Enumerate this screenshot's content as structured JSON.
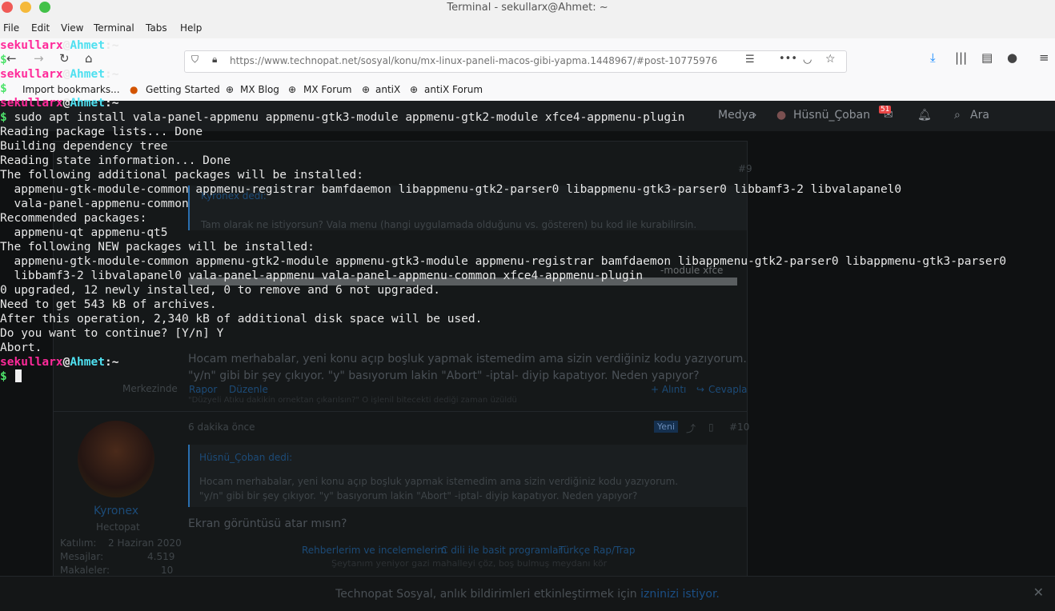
{
  "window": {
    "title": "Terminal - sekullarx@Ahmet: ~"
  },
  "menu": [
    "File",
    "Edit",
    "View",
    "Terminal",
    "Tabs",
    "Help"
  ],
  "browser": {
    "url": "https://www.technopat.net/sosyal/konu/mx-linux-paneli-macos-gibi-yapma.1448967/#post-10775976",
    "bookmarks": [
      "Import bookmarks...",
      "Getting Started",
      "MX Blog",
      "MX Forum",
      "antiX",
      "antiX Forum"
    ],
    "site_nav": {
      "media": "Medya",
      "user": "Hüsnü_Çoban",
      "notif_count": "51",
      "search": "Ara"
    },
    "post9": {
      "number": "#9",
      "quote_author": "Kyronex dedi:",
      "quote_text": "Tam olarak ne istiyorsun? Vala menu (hangi uygulamada olduğunu vs. gösteren) bu kod ile kurabilirsin.",
      "code_fragment": "-module xfce",
      "body_line1": "Hocam merhabalar, yeni konu açıp boşluk yapmak istemedim ama sizin verdiğiniz kodu yazıyorum.",
      "body_line2": "\"y/n\" gibi bir şey çıkıyor. \"y\" basıyorum lakin \"Abort\" -iptal- diyip kapatıyor. Neden yapıyor?",
      "edit_note": "\"Düzyeli Atıku dakikin ornektan çıkarılsın?\" O işlenil bitecekti dediği zaman üzüldü",
      "report": "Rapor",
      "edit": "Düzenle",
      "quote_btn": "+ Alıntı",
      "reply_btn": "Cevapla",
      "user_location": "Merkezinde"
    },
    "post10": {
      "time": "6 dakika önce",
      "badge": "Yeni",
      "number": "#10",
      "quote_author": "Hüsnü_Çoban dedi:",
      "quote_line1": "Hocam merhabalar, yeni konu açıp boşluk yapmak istemedim ama sizin verdiğiniz kodu yazıyorum.",
      "quote_line2": "\"y/n\" gibi bir şey çıkıyor. \"y\" basıyorum lakin \"Abort\" -iptal- diyip kapatıyor. Neden yapıyor?",
      "body": "Ekran görüntüsü atar mısın?",
      "signature_link1": "Rehberlerim ve incelemelerim",
      "signature_link2": "C dili ile basit programlar",
      "signature_link3": "Türkçe Rap/Trap",
      "signature_line2": "Şeytanım yeniyor gazi mahalleyi çöz, boş bulmuş meydanı kör"
    },
    "user": {
      "name": "Kyronex",
      "title": "Hectopat",
      "joined_label": "Katılım:",
      "joined_value": "2 Haziran 2020",
      "messages_label": "Mesajlar:",
      "messages_value": "4.519",
      "articles_label": "Makaleler:",
      "articles_value": "10"
    },
    "notice": {
      "text": "Technopat Sosyal, anlık bildirimleri etkinleştirmek için",
      "link": "izninizi istiyor."
    }
  },
  "terminal": {
    "prompt_user": "sekullarx",
    "prompt_at": "@",
    "prompt_host": "Ahmet",
    "prompt_path": ":~",
    "prompt_symbol": "$",
    "command": " sudo apt install vala-panel-appmenu appmenu-gtk3-module appmenu-gtk2-module xfce4-appmenu-plugin",
    "output": [
      "Reading package lists... Done",
      "Building dependency tree",
      "Reading state information... Done",
      "The following additional packages will be installed:",
      "  appmenu-gtk-module-common appmenu-registrar bamfdaemon libappmenu-gtk2-parser0 libappmenu-gtk3-parser0 libbamf3-2 libvalapanel0",
      "  vala-panel-appmenu-common",
      "Recommended packages:",
      "  appmenu-qt appmenu-qt5",
      "The following NEW packages will be installed:",
      "  appmenu-gtk-module-common appmenu-gtk2-module appmenu-gtk3-module appmenu-registrar bamfdaemon libappmenu-gtk2-parser0 libappmenu-gtk3-parser0",
      "  libbamf3-2 libvalapanel0 vala-panel-appmenu vala-panel-appmenu-common xfce4-appmenu-plugin",
      "0 upgraded, 12 newly installed, 0 to remove and 6 not upgraded.",
      "Need to get 543 kB of archives.",
      "After this operation, 2,340 kB of additional disk space will be used.",
      "Do you want to continue? [Y/n] Y",
      "Abort."
    ]
  }
}
